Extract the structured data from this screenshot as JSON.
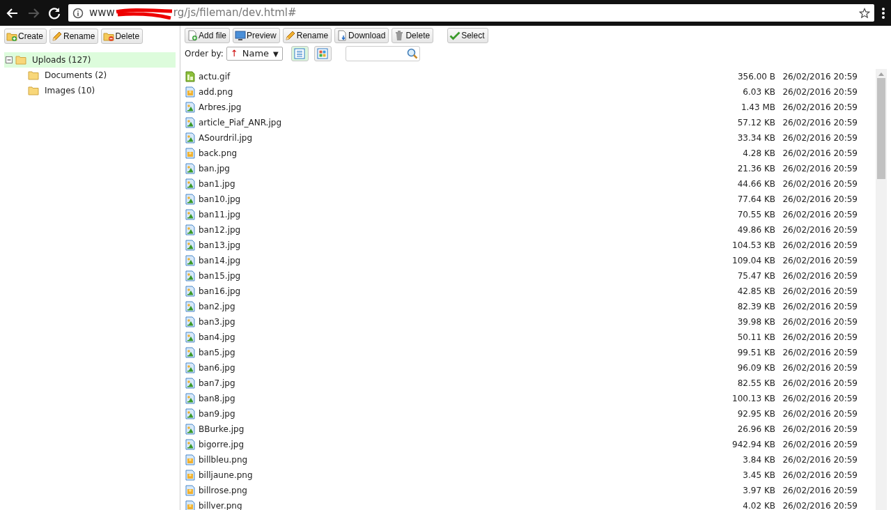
{
  "browser": {
    "url_start": "www",
    "url_end": "rg/js/fileman/dev.html#"
  },
  "sidebar": {
    "buttons": [
      {
        "label": "Create",
        "kind": "folder-add"
      },
      {
        "label": "Rename",
        "kind": "pencil"
      },
      {
        "label": "Delete",
        "kind": "folder-delete"
      }
    ],
    "tree": [
      {
        "label": "Uploads (127)",
        "selected": true,
        "expanded": true,
        "children": [
          {
            "label": "Documents (2)",
            "selected": false
          },
          {
            "label": "Images (10)",
            "selected": false
          }
        ]
      }
    ]
  },
  "toolbar": {
    "buttons": [
      {
        "label": "Add file",
        "kind": "file-add"
      },
      {
        "label": "Preview",
        "kind": "monitor"
      },
      {
        "label": "Rename",
        "kind": "pencil"
      },
      {
        "label": "Download",
        "kind": "file-down"
      },
      {
        "label": "Delete",
        "kind": "trash"
      },
      {
        "label": "Select",
        "kind": "check"
      }
    ],
    "order_label": "Order by:",
    "sort_arrow": "↑",
    "order_value": "Name",
    "order_caret": "▼",
    "views": [
      {
        "kind": "list",
        "selected": true
      },
      {
        "kind": "grid",
        "selected": false
      }
    ]
  },
  "files": [
    {
      "name": "actu.gif",
      "kind": "gif",
      "size": "356.00 B",
      "date": "26/02/2016 20:59"
    },
    {
      "name": "add.png",
      "kind": "png",
      "size": "6.03 KB",
      "date": "26/02/2016 20:59"
    },
    {
      "name": "Arbres.jpg",
      "kind": "jpg",
      "size": "1.43 MB",
      "date": "26/02/2016 20:59"
    },
    {
      "name": "article_Piaf_ANR.jpg",
      "kind": "jpg",
      "size": "57.12 KB",
      "date": "26/02/2016 20:59"
    },
    {
      "name": "ASourdril.jpg",
      "kind": "jpg",
      "size": "33.34 KB",
      "date": "26/02/2016 20:59"
    },
    {
      "name": "back.png",
      "kind": "png",
      "size": "4.28 KB",
      "date": "26/02/2016 20:59"
    },
    {
      "name": "ban.jpg",
      "kind": "jpg",
      "size": "21.36 KB",
      "date": "26/02/2016 20:59"
    },
    {
      "name": "ban1.jpg",
      "kind": "jpg",
      "size": "44.66 KB",
      "date": "26/02/2016 20:59"
    },
    {
      "name": "ban10.jpg",
      "kind": "jpg",
      "size": "77.64 KB",
      "date": "26/02/2016 20:59"
    },
    {
      "name": "ban11.jpg",
      "kind": "jpg",
      "size": "70.55 KB",
      "date": "26/02/2016 20:59"
    },
    {
      "name": "ban12.jpg",
      "kind": "jpg",
      "size": "49.86 KB",
      "date": "26/02/2016 20:59"
    },
    {
      "name": "ban13.jpg",
      "kind": "jpg",
      "size": "104.53 KB",
      "date": "26/02/2016 20:59"
    },
    {
      "name": "ban14.jpg",
      "kind": "jpg",
      "size": "109.04 KB",
      "date": "26/02/2016 20:59"
    },
    {
      "name": "ban15.jpg",
      "kind": "jpg",
      "size": "75.47 KB",
      "date": "26/02/2016 20:59"
    },
    {
      "name": "ban16.jpg",
      "kind": "jpg",
      "size": "42.85 KB",
      "date": "26/02/2016 20:59"
    },
    {
      "name": "ban2.jpg",
      "kind": "jpg",
      "size": "82.39 KB",
      "date": "26/02/2016 20:59"
    },
    {
      "name": "ban3.jpg",
      "kind": "jpg",
      "size": "39.98 KB",
      "date": "26/02/2016 20:59"
    },
    {
      "name": "ban4.jpg",
      "kind": "jpg",
      "size": "50.11 KB",
      "date": "26/02/2016 20:59"
    },
    {
      "name": "ban5.jpg",
      "kind": "jpg",
      "size": "99.51 KB",
      "date": "26/02/2016 20:59"
    },
    {
      "name": "ban6.jpg",
      "kind": "jpg",
      "size": "96.09 KB",
      "date": "26/02/2016 20:59"
    },
    {
      "name": "ban7.jpg",
      "kind": "jpg",
      "size": "82.55 KB",
      "date": "26/02/2016 20:59"
    },
    {
      "name": "ban8.jpg",
      "kind": "jpg",
      "size": "100.13 KB",
      "date": "26/02/2016 20:59"
    },
    {
      "name": "ban9.jpg",
      "kind": "jpg",
      "size": "92.95 KB",
      "date": "26/02/2016 20:59"
    },
    {
      "name": "BBurke.jpg",
      "kind": "jpg",
      "size": "26.96 KB",
      "date": "26/02/2016 20:59"
    },
    {
      "name": "bigorre.jpg",
      "kind": "jpg",
      "size": "942.94 KB",
      "date": "26/02/2016 20:59"
    },
    {
      "name": "billbleu.png",
      "kind": "png",
      "size": "3.84 KB",
      "date": "26/02/2016 20:59"
    },
    {
      "name": "billjaune.png",
      "kind": "png",
      "size": "3.45 KB",
      "date": "26/02/2016 20:59"
    },
    {
      "name": "billrose.png",
      "kind": "png",
      "size": "3.97 KB",
      "date": "26/02/2016 20:59"
    },
    {
      "name": "billver.png",
      "kind": "png",
      "size": "4.02 KB",
      "date": "26/02/2016 20:59"
    }
  ]
}
